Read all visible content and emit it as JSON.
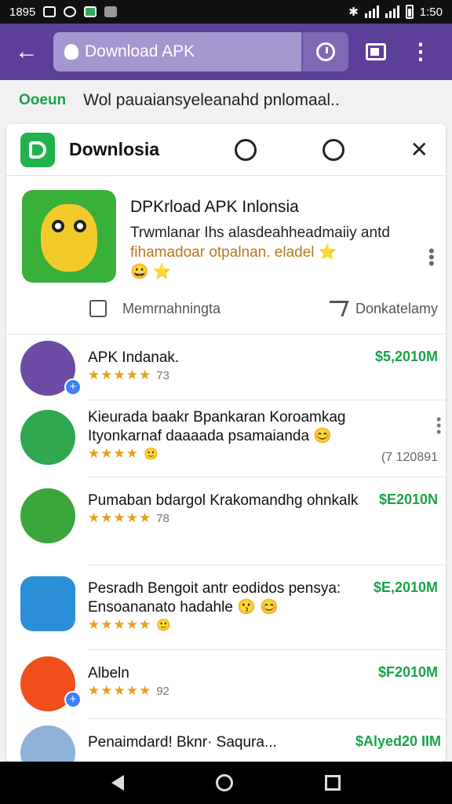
{
  "status_bar": {
    "time_left": "1895",
    "time_right": "1:50"
  },
  "app_bar": {
    "search_value": "Download APK",
    "back_icon": "arrow-left-icon",
    "timer_icon": "timer-icon",
    "tabs_icon": "tabs-icon",
    "more_icon": "more-vert-icon"
  },
  "info": {
    "brand": "Ooeun",
    "text": "Wol pauaiansyeleanahd pnlomaal.."
  },
  "card_header": {
    "title": "Downlosia"
  },
  "featured": {
    "title": "DPKrload APK Inlonsia",
    "desc_line1": "Trwmlanar Ihs alasdeahheadmaiiy antd",
    "desc_line2": "fihamadoar otpalnan. eladel ⭐",
    "emoji": "😀 ⭐",
    "like_label": "Memrnahningta",
    "share_label": "Donkatelamy"
  },
  "list": [
    {
      "name": "APK Indanak.",
      "stars": "★★★★★",
      "count": "73",
      "price": "$5,2010M",
      "color": "#6d4aa3"
    },
    {
      "name": "Kieurada baakr Bpankaran Koroamkag Ityonkarnaf daaaada psamaianda 😊",
      "stars": "★★★★",
      "count": "🙂",
      "alt": "(7 120891",
      "color": "#2fa84f"
    },
    {
      "name": "Pumaban bdargol Krakomandhg ohnkalk",
      "stars": "★★★★★",
      "count": "78",
      "price": "$E2010N",
      "color": "#3aa63a"
    },
    {
      "name": "Pesradh Bengoit antr eodidos pensya: Ensoananato hadahle 😗 😊",
      "stars": "★★★★★",
      "count": "🙂",
      "price": "$E,2010M",
      "color": "#2a8fd6"
    },
    {
      "name": "Albeln",
      "stars": "★★★★★",
      "count": "92",
      "price": "$F2010M",
      "color": "#f04f1b"
    },
    {
      "name": "Penaimdard! Bknr· Saqura...",
      "stars": "",
      "count": "😉",
      "price": "$Alyed20 IIM",
      "color": "#8fb3d8"
    }
  ]
}
